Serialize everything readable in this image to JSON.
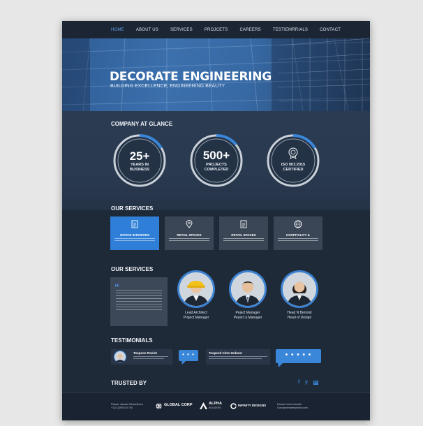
{
  "nav": {
    "items": [
      "HOME",
      "ABOUT US",
      "SERVICES",
      "PROJCETS",
      "CAREERS",
      "TESTIEMRRIALS",
      "CONTACT"
    ],
    "active_index": 0
  },
  "hero": {
    "title": "DECORATE ENGINEERING",
    "subtitle": "BUILDING EXCELLENCE, ENGINEERING BEAUTY"
  },
  "glance": {
    "title": "COMPANY AT GLANCE",
    "stats": [
      {
        "value": "25+",
        "caption_1": "YEARS IN",
        "caption_2": "BUSINESS",
        "progress": 0.15
      },
      {
        "value": "500+",
        "caption_1": "PROJECTS",
        "caption_2": "COMPLETED",
        "progress": 0.12
      },
      {
        "value": "",
        "caption_1": "ISO 901:2015",
        "caption_2": "CERTIFIED",
        "progress": 0.15,
        "icon": "certificate-icon"
      }
    ]
  },
  "services": {
    "title": "OUR SERVICES",
    "items": [
      {
        "label": "OFFICE INTERIORS",
        "icon": "document-icon",
        "active": true
      },
      {
        "label": "RETAIL SPACES",
        "icon": "location-pin-icon",
        "active": false
      },
      {
        "label": "RETAIL SPACES",
        "icon": "document-icon",
        "active": false
      },
      {
        "label": "HOSPITALITY &",
        "icon": "globe-icon",
        "active": false
      }
    ]
  },
  "team": {
    "title": "OUR SERVICES",
    "members": [
      {
        "name": "Lead Architect",
        "role": "Project Manager"
      },
      {
        "name": "Peject Manager",
        "role": "Peyect a Manager"
      },
      {
        "name": "Head N Benonit",
        "role": "Head of Design"
      }
    ]
  },
  "testimonials": {
    "title": "TESTIMONIALS",
    "cards": [
      {
        "name": "Toepoon Roeint"
      },
      {
        "name": "Toepeod Clom Enboot"
      }
    ],
    "bubble_dots_1": "• • •",
    "bubble_dots_2": "• • • • •"
  },
  "trusted": {
    "title": "TRUSTED BY",
    "social": [
      "f",
      "y",
      "in"
    ]
  },
  "footer": {
    "contact_1": "Paane: causon Mossdecon",
    "contact_2": "+123 (292) 00 700",
    "brands": [
      "GLOBAL CORP",
      "ALPHA",
      "INFINITY DESIGNS"
    ],
    "brand_sub_2": "BUILDERS",
    "right_1": "Dooare Ummmonder",
    "right_2": "Goroponendmachide.com"
  },
  "colors": {
    "accent": "#2f7fd8",
    "page_bg": "#1f2a39",
    "hero_blue": "#3b70ad"
  }
}
